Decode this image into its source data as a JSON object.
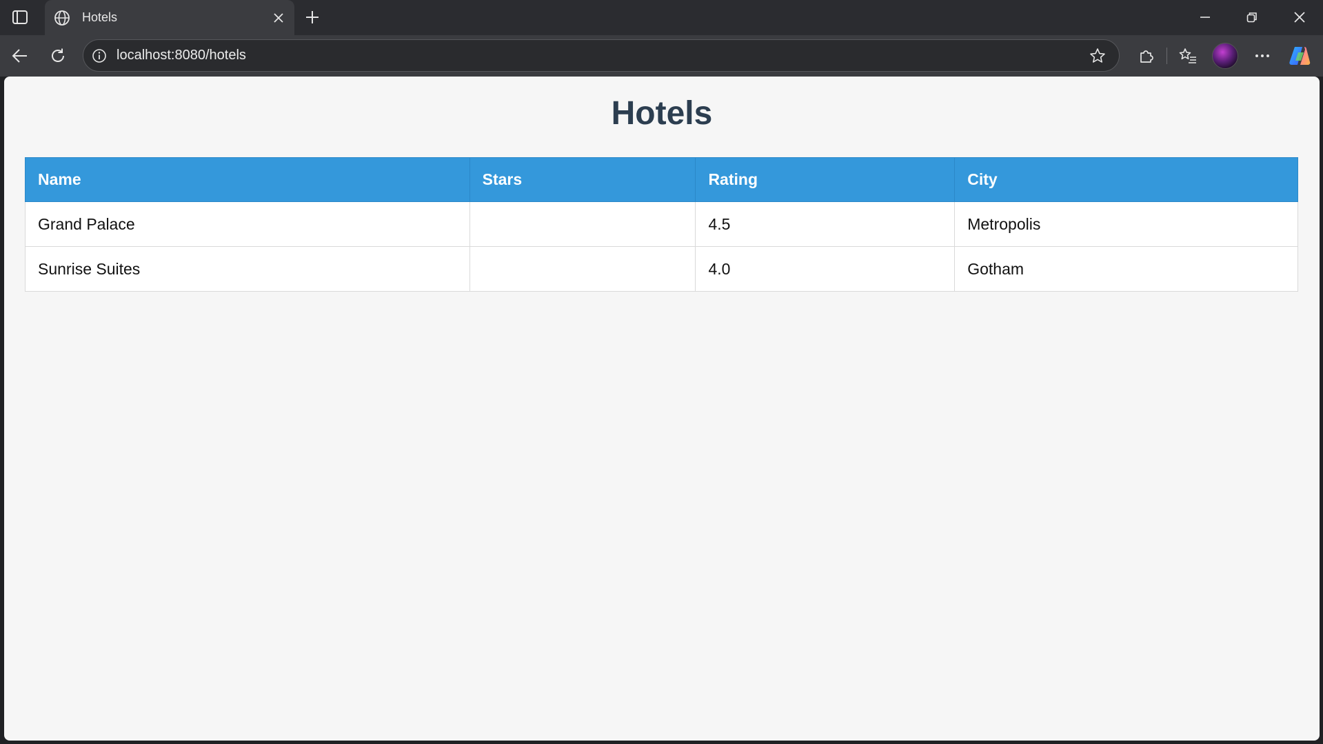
{
  "browser": {
    "tab_title": "Hotels",
    "url": "localhost:8080/hotels",
    "icons": {
      "sidebar": "sidebar-toggle-icon",
      "favicon": "globe-icon",
      "close_tab": "close-icon",
      "new_tab": "plus-icon",
      "back": "back-arrow-icon",
      "reload": "reload-icon",
      "site_info": "info-icon",
      "favorite": "star-icon",
      "extensions": "puzzle-icon",
      "favorites": "favorites-list-icon",
      "menu": "more-icon",
      "copilot": "copilot-icon"
    }
  },
  "page": {
    "title": "Hotels",
    "table": {
      "headers": [
        "Name",
        "Stars",
        "Rating",
        "City"
      ],
      "rows": [
        [
          "Grand Palace",
          "",
          "4.5",
          "Metropolis"
        ],
        [
          "Sunrise Suites",
          "",
          "4.0",
          "Gotham"
        ]
      ]
    }
  },
  "colors": {
    "header_bg": "#3498db",
    "title": "#2c3e50",
    "page_bg": "#f6f6f6"
  }
}
